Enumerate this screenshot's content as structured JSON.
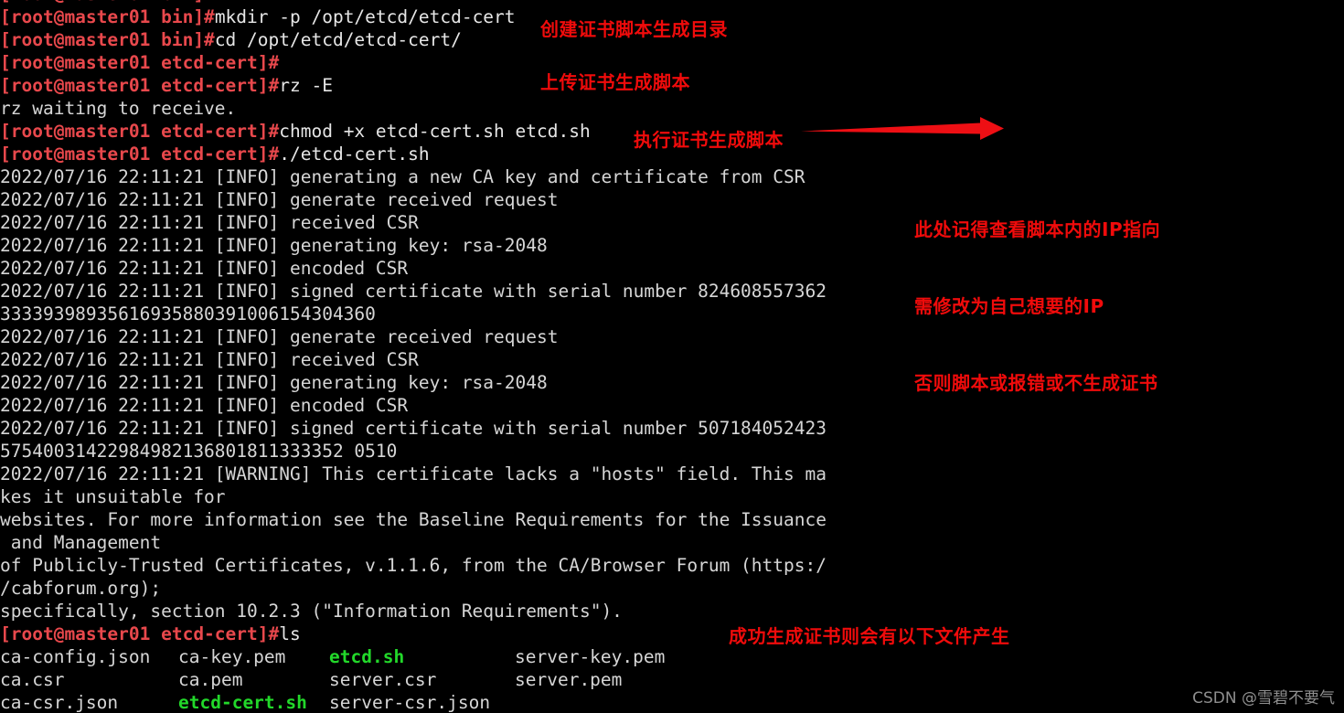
{
  "terminal": {
    "host": "master01",
    "user": "root",
    "prompt_bin": "[root@master01 bin]#",
    "prompt_cert": "[root@master01 etcd-cert]#",
    "lines": [
      {
        "type": "command",
        "prompt": "[root@master01 bin]#",
        "text": "mkdir -p /opt/etcd/etcd-cert"
      },
      {
        "type": "command",
        "prompt": "[root@master01 bin]#",
        "text": "cd /opt/etcd/etcd-cert/"
      },
      {
        "type": "command",
        "prompt": "[root@master01 etcd-cert]#",
        "text": ""
      },
      {
        "type": "command",
        "prompt": "[root@master01 etcd-cert]#",
        "text": "rz -E"
      },
      {
        "type": "output",
        "text": "rz waiting to receive."
      },
      {
        "type": "command",
        "prompt": "[root@master01 etcd-cert]#",
        "text": "chmod +x etcd-cert.sh etcd.sh"
      },
      {
        "type": "command",
        "prompt": "[root@master01 etcd-cert]#",
        "text": "./etcd-cert.sh"
      },
      {
        "type": "output",
        "text": "2022/07/16 22:11:21 [INFO] generating a new CA key and certificate from CSR"
      },
      {
        "type": "output",
        "text": "2022/07/16 22:11:21 [INFO] generate received request"
      },
      {
        "type": "output",
        "text": "2022/07/16 22:11:21 [INFO] received CSR"
      },
      {
        "type": "output",
        "text": "2022/07/16 22:11:21 [INFO] generating key: rsa-2048"
      },
      {
        "type": "output",
        "text": "2022/07/16 22:11:21 [INFO] encoded CSR"
      },
      {
        "type": "output",
        "text": "2022/07/16 22:11:21 [INFO] signed certificate with serial number 824608557362"
      },
      {
        "type": "output",
        "text": "33339398935616935880391006154304360"
      },
      {
        "type": "output",
        "text": "2022/07/16 22:11:21 [INFO] generate received request"
      },
      {
        "type": "output",
        "text": "2022/07/16 22:11:21 [INFO] received CSR"
      },
      {
        "type": "output",
        "text": "2022/07/16 22:11:21 [INFO] generating key: rsa-2048"
      },
      {
        "type": "output",
        "text": "2022/07/16 22:11:21 [INFO] encoded CSR"
      },
      {
        "type": "output",
        "text": "2022/07/16 22:11:21 [INFO] signed certificate with serial number 507184052423"
      },
      {
        "type": "output",
        "text": "57540031422984982136801811333352 0510"
      },
      {
        "type": "output",
        "text": "2022/07/16 22:11:21 [WARNING] This certificate lacks a \"hosts\" field. This ma"
      },
      {
        "type": "output",
        "text": "kes it unsuitable for"
      },
      {
        "type": "output",
        "text": "websites. For more information see the Baseline Requirements for the Issuance"
      },
      {
        "type": "output",
        "text": " and Management"
      },
      {
        "type": "output",
        "text": "of Publicly-Trusted Certificates, v.1.1.6, from the CA/Browser Forum (https:/"
      },
      {
        "type": "output",
        "text": "/cabforum.org);"
      },
      {
        "type": "output",
        "text": "specifically, section 10.2.3 (\"Information Requirements\")."
      }
    ],
    "ls_command": {
      "prompt": "[root@master01 etcd-cert]#",
      "text": "ls"
    },
    "ls_output": [
      [
        {
          "name": "ca-config.json",
          "color": "white"
        },
        {
          "name": "ca-key.pem",
          "color": "white"
        },
        {
          "name": "etcd.sh",
          "color": "green"
        },
        {
          "name": "server-key.pem",
          "color": "white"
        }
      ],
      [
        {
          "name": "ca.csr",
          "color": "white"
        },
        {
          "name": "ca.pem",
          "color": "white"
        },
        {
          "name": "server.csr",
          "color": "white"
        },
        {
          "name": "server.pem",
          "color": "white"
        }
      ],
      [
        {
          "name": "ca-csr.json",
          "color": "white"
        },
        {
          "name": "etcd-cert.sh",
          "color": "green"
        },
        {
          "name": "server-csr.json",
          "color": "white"
        },
        {
          "name": "",
          "color": "white"
        }
      ]
    ]
  },
  "annotations": {
    "mkdir": "创建证书脚本生成目录",
    "upload": "上传证书生成脚本",
    "exec": "执行证书生成脚本",
    "ip_note_line1": "此处记得查看脚本内的IP指向",
    "ip_note_line2": "需修改为自己想要的IP",
    "ip_note_line3": "否则脚本或报错或不生成证书",
    "files": "成功生成证书则会有以下文件产生"
  },
  "watermark": "CSDN @雪碧不要气",
  "colors": {
    "background": "#000000",
    "prompt_red": "#e8484c",
    "output_white": "#d8d8d8",
    "executable_green": "#22d82a",
    "annotation_red": "#f00b0b",
    "watermark_grey": "#8f8f8f"
  }
}
